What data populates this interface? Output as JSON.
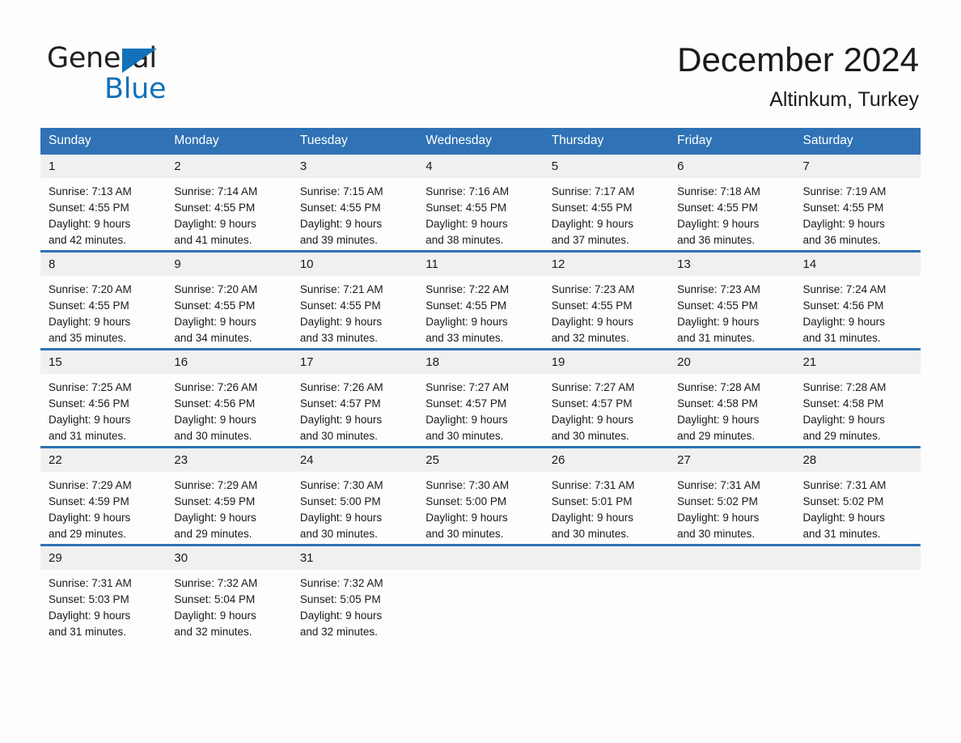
{
  "brand": {
    "name_part1": "General",
    "name_part2": "Blue",
    "triangle_color": "#1271b8"
  },
  "header": {
    "title": "December 2024",
    "subtitle": "Altinkum, Turkey"
  },
  "theme": {
    "header_blue": "#2f72b5",
    "daynum_band": "#f0f0f0",
    "text": "#1a1a1a",
    "page_bg": "#fdfdfd"
  },
  "calendar": {
    "weekday_headers": [
      "Sunday",
      "Monday",
      "Tuesday",
      "Wednesday",
      "Thursday",
      "Friday",
      "Saturday"
    ],
    "labels": {
      "sunrise": "Sunrise:",
      "sunset": "Sunset:",
      "daylight": "Daylight:"
    },
    "weeks": [
      [
        {
          "day": "1",
          "sunrise": "Sunrise: 7:13 AM",
          "sunset": "Sunset: 4:55 PM",
          "daylight1": "Daylight: 9 hours",
          "daylight2": "and 42 minutes."
        },
        {
          "day": "2",
          "sunrise": "Sunrise: 7:14 AM",
          "sunset": "Sunset: 4:55 PM",
          "daylight1": "Daylight: 9 hours",
          "daylight2": "and 41 minutes."
        },
        {
          "day": "3",
          "sunrise": "Sunrise: 7:15 AM",
          "sunset": "Sunset: 4:55 PM",
          "daylight1": "Daylight: 9 hours",
          "daylight2": "and 39 minutes."
        },
        {
          "day": "4",
          "sunrise": "Sunrise: 7:16 AM",
          "sunset": "Sunset: 4:55 PM",
          "daylight1": "Daylight: 9 hours",
          "daylight2": "and 38 minutes."
        },
        {
          "day": "5",
          "sunrise": "Sunrise: 7:17 AM",
          "sunset": "Sunset: 4:55 PM",
          "daylight1": "Daylight: 9 hours",
          "daylight2": "and 37 minutes."
        },
        {
          "day": "6",
          "sunrise": "Sunrise: 7:18 AM",
          "sunset": "Sunset: 4:55 PM",
          "daylight1": "Daylight: 9 hours",
          "daylight2": "and 36 minutes."
        },
        {
          "day": "7",
          "sunrise": "Sunrise: 7:19 AM",
          "sunset": "Sunset: 4:55 PM",
          "daylight1": "Daylight: 9 hours",
          "daylight2": "and 36 minutes."
        }
      ],
      [
        {
          "day": "8",
          "sunrise": "Sunrise: 7:20 AM",
          "sunset": "Sunset: 4:55 PM",
          "daylight1": "Daylight: 9 hours",
          "daylight2": "and 35 minutes."
        },
        {
          "day": "9",
          "sunrise": "Sunrise: 7:20 AM",
          "sunset": "Sunset: 4:55 PM",
          "daylight1": "Daylight: 9 hours",
          "daylight2": "and 34 minutes."
        },
        {
          "day": "10",
          "sunrise": "Sunrise: 7:21 AM",
          "sunset": "Sunset: 4:55 PM",
          "daylight1": "Daylight: 9 hours",
          "daylight2": "and 33 minutes."
        },
        {
          "day": "11",
          "sunrise": "Sunrise: 7:22 AM",
          "sunset": "Sunset: 4:55 PM",
          "daylight1": "Daylight: 9 hours",
          "daylight2": "and 33 minutes."
        },
        {
          "day": "12",
          "sunrise": "Sunrise: 7:23 AM",
          "sunset": "Sunset: 4:55 PM",
          "daylight1": "Daylight: 9 hours",
          "daylight2": "and 32 minutes."
        },
        {
          "day": "13",
          "sunrise": "Sunrise: 7:23 AM",
          "sunset": "Sunset: 4:55 PM",
          "daylight1": "Daylight: 9 hours",
          "daylight2": "and 31 minutes."
        },
        {
          "day": "14",
          "sunrise": "Sunrise: 7:24 AM",
          "sunset": "Sunset: 4:56 PM",
          "daylight1": "Daylight: 9 hours",
          "daylight2": "and 31 minutes."
        }
      ],
      [
        {
          "day": "15",
          "sunrise": "Sunrise: 7:25 AM",
          "sunset": "Sunset: 4:56 PM",
          "daylight1": "Daylight: 9 hours",
          "daylight2": "and 31 minutes."
        },
        {
          "day": "16",
          "sunrise": "Sunrise: 7:26 AM",
          "sunset": "Sunset: 4:56 PM",
          "daylight1": "Daylight: 9 hours",
          "daylight2": "and 30 minutes."
        },
        {
          "day": "17",
          "sunrise": "Sunrise: 7:26 AM",
          "sunset": "Sunset: 4:57 PM",
          "daylight1": "Daylight: 9 hours",
          "daylight2": "and 30 minutes."
        },
        {
          "day": "18",
          "sunrise": "Sunrise: 7:27 AM",
          "sunset": "Sunset: 4:57 PM",
          "daylight1": "Daylight: 9 hours",
          "daylight2": "and 30 minutes."
        },
        {
          "day": "19",
          "sunrise": "Sunrise: 7:27 AM",
          "sunset": "Sunset: 4:57 PM",
          "daylight1": "Daylight: 9 hours",
          "daylight2": "and 30 minutes."
        },
        {
          "day": "20",
          "sunrise": "Sunrise: 7:28 AM",
          "sunset": "Sunset: 4:58 PM",
          "daylight1": "Daylight: 9 hours",
          "daylight2": "and 29 minutes."
        },
        {
          "day": "21",
          "sunrise": "Sunrise: 7:28 AM",
          "sunset": "Sunset: 4:58 PM",
          "daylight1": "Daylight: 9 hours",
          "daylight2": "and 29 minutes."
        }
      ],
      [
        {
          "day": "22",
          "sunrise": "Sunrise: 7:29 AM",
          "sunset": "Sunset: 4:59 PM",
          "daylight1": "Daylight: 9 hours",
          "daylight2": "and 29 minutes."
        },
        {
          "day": "23",
          "sunrise": "Sunrise: 7:29 AM",
          "sunset": "Sunset: 4:59 PM",
          "daylight1": "Daylight: 9 hours",
          "daylight2": "and 29 minutes."
        },
        {
          "day": "24",
          "sunrise": "Sunrise: 7:30 AM",
          "sunset": "Sunset: 5:00 PM",
          "daylight1": "Daylight: 9 hours",
          "daylight2": "and 30 minutes."
        },
        {
          "day": "25",
          "sunrise": "Sunrise: 7:30 AM",
          "sunset": "Sunset: 5:00 PM",
          "daylight1": "Daylight: 9 hours",
          "daylight2": "and 30 minutes."
        },
        {
          "day": "26",
          "sunrise": "Sunrise: 7:31 AM",
          "sunset": "Sunset: 5:01 PM",
          "daylight1": "Daylight: 9 hours",
          "daylight2": "and 30 minutes."
        },
        {
          "day": "27",
          "sunrise": "Sunrise: 7:31 AM",
          "sunset": "Sunset: 5:02 PM",
          "daylight1": "Daylight: 9 hours",
          "daylight2": "and 30 minutes."
        },
        {
          "day": "28",
          "sunrise": "Sunrise: 7:31 AM",
          "sunset": "Sunset: 5:02 PM",
          "daylight1": "Daylight: 9 hours",
          "daylight2": "and 31 minutes."
        }
      ],
      [
        {
          "day": "29",
          "sunrise": "Sunrise: 7:31 AM",
          "sunset": "Sunset: 5:03 PM",
          "daylight1": "Daylight: 9 hours",
          "daylight2": "and 31 minutes."
        },
        {
          "day": "30",
          "sunrise": "Sunrise: 7:32 AM",
          "sunset": "Sunset: 5:04 PM",
          "daylight1": "Daylight: 9 hours",
          "daylight2": "and 32 minutes."
        },
        {
          "day": "31",
          "sunrise": "Sunrise: 7:32 AM",
          "sunset": "Sunset: 5:05 PM",
          "daylight1": "Daylight: 9 hours",
          "daylight2": "and 32 minutes."
        },
        {
          "day": "",
          "sunrise": "",
          "sunset": "",
          "daylight1": "",
          "daylight2": ""
        },
        {
          "day": "",
          "sunrise": "",
          "sunset": "",
          "daylight1": "",
          "daylight2": ""
        },
        {
          "day": "",
          "sunrise": "",
          "sunset": "",
          "daylight1": "",
          "daylight2": ""
        },
        {
          "day": "",
          "sunrise": "",
          "sunset": "",
          "daylight1": "",
          "daylight2": ""
        }
      ]
    ]
  }
}
